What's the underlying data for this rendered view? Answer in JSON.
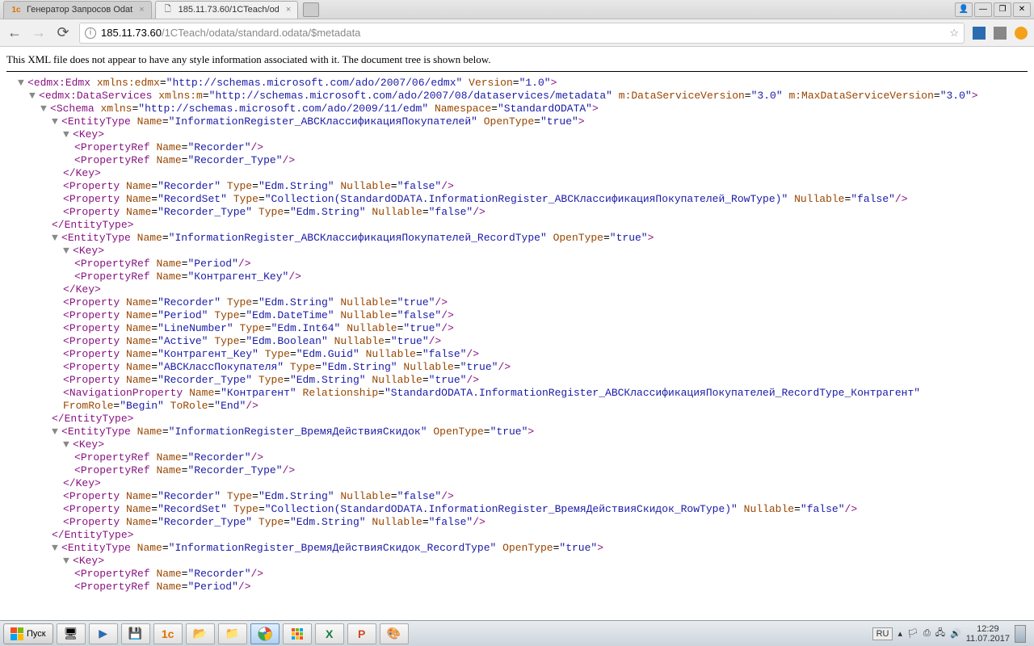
{
  "tabs": [
    {
      "title": "Генератор Запросов Odat",
      "active": false
    },
    {
      "title": "185.11.73.60/1CTeach/od",
      "active": true
    }
  ],
  "url": {
    "host": "185.11.73.60",
    "path": "/1CTeach/odata/standard.odata/$metadata"
  },
  "notice": "This XML file does not appear to have any style information associated with it. The document tree is shown below.",
  "xml": {
    "edmx": {
      "xmlns": "http://schemas.microsoft.com/ado/2007/06/edmx",
      "version": "1.0"
    },
    "ds": {
      "xmlnsm": "http://schemas.microsoft.com/ado/2007/08/dataservices/metadata",
      "dsv": "3.0",
      "maxdsv": "3.0"
    },
    "schema": {
      "xmlns": "http://schemas.microsoft.com/ado/2009/11/edm",
      "ns": "StandardODATA"
    },
    "et1": {
      "name": "InformationRegister_АВСКлассификацияПокупателей",
      "open": "true",
      "keys": [
        "Recorder",
        "Recorder_Type"
      ],
      "props": [
        {
          "n": "Recorder",
          "t": "Edm.String",
          "nl": "false"
        },
        {
          "n": "RecordSet",
          "t": "Collection(StandardODATA.InformationRegister_АВСКлассификацияПокупателей_RowType)",
          "nl": "false"
        },
        {
          "n": "Recorder_Type",
          "t": "Edm.String",
          "nl": "false"
        }
      ]
    },
    "et2": {
      "name": "InformationRegister_АВСКлассификацияПокупателей_RecordType",
      "open": "true",
      "keys": [
        "Period",
        "Контрагент_Key"
      ],
      "props": [
        {
          "n": "Recorder",
          "t": "Edm.String",
          "nl": "true"
        },
        {
          "n": "Period",
          "t": "Edm.DateTime",
          "nl": "false"
        },
        {
          "n": "LineNumber",
          "t": "Edm.Int64",
          "nl": "true"
        },
        {
          "n": "Active",
          "t": "Edm.Boolean",
          "nl": "true"
        },
        {
          "n": "Контрагент_Key",
          "t": "Edm.Guid",
          "nl": "false"
        },
        {
          "n": "АВСКлассПокупателя",
          "t": "Edm.String",
          "nl": "true"
        },
        {
          "n": "Recorder_Type",
          "t": "Edm.String",
          "nl": "true"
        }
      ],
      "nav": {
        "n": "Контрагент",
        "rel": "StandardODATA.InformationRegister_АВСКлассификацияПокупателей_RecordType_Контрагент",
        "from": "Begin",
        "to": "End"
      }
    },
    "et3": {
      "name": "InformationRegister_ВремяДействияСкидок",
      "open": "true",
      "keys": [
        "Recorder",
        "Recorder_Type"
      ],
      "props": [
        {
          "n": "Recorder",
          "t": "Edm.String",
          "nl": "false"
        },
        {
          "n": "RecordSet",
          "t": "Collection(StandardODATA.InformationRegister_ВремяДействияСкидок_RowType)",
          "nl": "false"
        },
        {
          "n": "Recorder_Type",
          "t": "Edm.String",
          "nl": "false"
        }
      ]
    },
    "et4": {
      "name": "InformationRegister_ВремяДействияСкидок_RecordType",
      "open": "true",
      "keys": [
        "Recorder",
        "Period"
      ]
    }
  },
  "taskbar": {
    "start": "Пуск",
    "lang": "RU",
    "time": "12:29",
    "date": "11.07.2017"
  }
}
